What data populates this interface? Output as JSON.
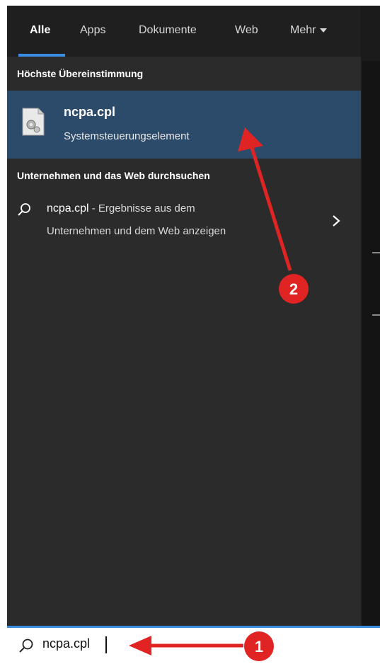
{
  "tabs": [
    {
      "label": "Alle",
      "active": true
    },
    {
      "label": "Apps",
      "active": false
    },
    {
      "label": "Dokumente",
      "active": false
    },
    {
      "label": "Web",
      "active": false
    },
    {
      "label": "Mehr",
      "active": false
    }
  ],
  "best_match": {
    "section_title": "Höchste Übereinstimmung",
    "title": "ncpa.cpl",
    "subtitle": "Systemsteuerungselement",
    "icon": "control-panel-file-icon"
  },
  "web_search": {
    "section_title": "Unternehmen und das Web durchsuchen",
    "query": "ncpa.cpl",
    "suffix": " - Ergebnisse aus dem",
    "line2": "Unternehmen und dem Web anzeigen",
    "icon": "search-icon",
    "chevron": "chevron-right-icon"
  },
  "searchbar": {
    "value": "ncpa.cpl",
    "icon": "search-icon"
  },
  "annotations": [
    {
      "label": "1",
      "color": "#e02424"
    },
    {
      "label": "2",
      "color": "#e02424"
    }
  ],
  "colors": {
    "panel_bg": "#2b2b2b",
    "tabs_bg": "#1f1f1f",
    "selection_bg": "#2c4b6b",
    "accent": "#3b8de3",
    "annotation_red": "#e02424"
  }
}
